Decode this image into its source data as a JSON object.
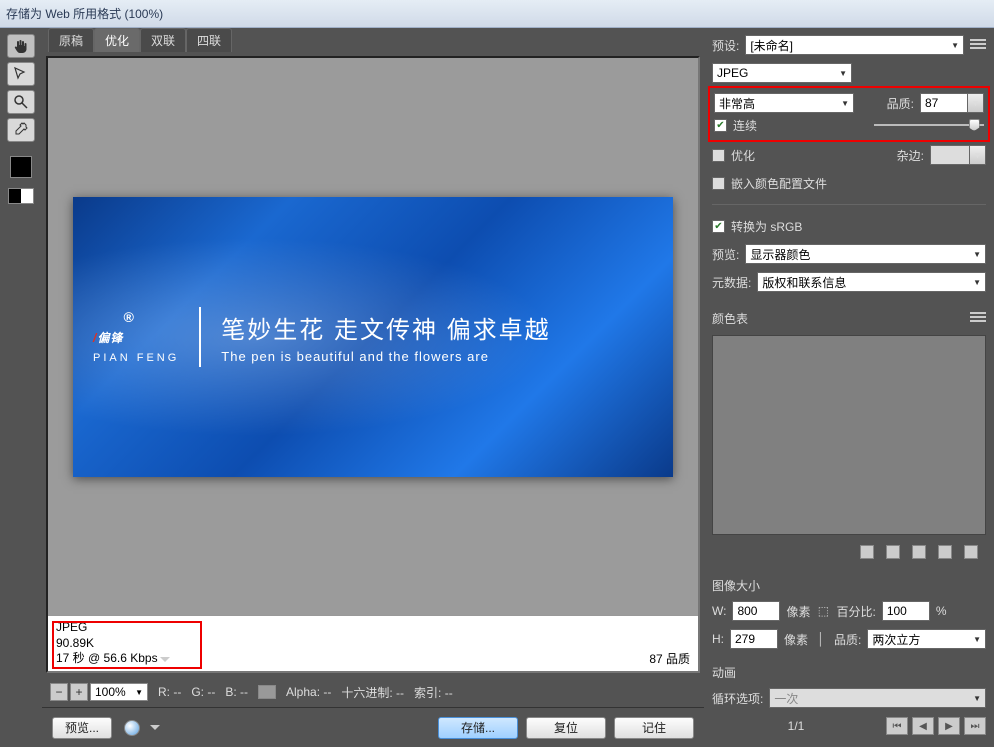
{
  "window": {
    "title": "存储为 Web 所用格式 (100%)"
  },
  "tabs": [
    "原稿",
    "优化",
    "双联",
    "四联"
  ],
  "active_tab_index": 1,
  "preview": {
    "logo_cn": "偏锋",
    "logo_accent": "/",
    "logo_pinyin": "PIAN FENG",
    "reg": "®",
    "slogan_cn": "笔妙生花  走文传神  偏求卓越",
    "slogan_en": "The pen is beautiful and the flowers are"
  },
  "preview_info": {
    "format": "JPEG",
    "size": "90.89K",
    "time": "17 秒 @ 56.6 Kbps",
    "quality_label": "87 品质"
  },
  "bottom": {
    "zoom": "100%",
    "r": "R: --",
    "g": "G: --",
    "b": "B: --",
    "alpha": "Alpha: --",
    "hex": "十六进制: --",
    "index": "索引: --"
  },
  "footer": {
    "preview": "预览...",
    "save": "存储...",
    "reset": "复位",
    "remember": "记住"
  },
  "right": {
    "preset_label": "预设:",
    "preset_value": "[未命名]",
    "format": "JPEG",
    "quality_preset": "非常高",
    "quality_label": "品质:",
    "quality_value": "87",
    "progressive": "连续",
    "optimize": "优化",
    "matte_label": "杂边:",
    "embed_profile": "嵌入颜色配置文件",
    "convert_srgb": "转换为 sRGB",
    "preview_label": "预览:",
    "preview_value": "显示器颜色",
    "metadata_label": "元数据:",
    "metadata_value": "版权和联系信息",
    "colortable_label": "颜色表",
    "imagesize_label": "图像大小",
    "w_label": "W:",
    "w_value": "800",
    "h_label": "H:",
    "h_value": "279",
    "pixels": "像素",
    "percent_label": "百分比:",
    "percent_value": "100",
    "percent_unit": "%",
    "resample_label": "品质:",
    "resample_value": "两次立方",
    "anim_label": "动画",
    "loop_label": "循环选项:",
    "loop_value": "一次",
    "frame": "1/1"
  }
}
